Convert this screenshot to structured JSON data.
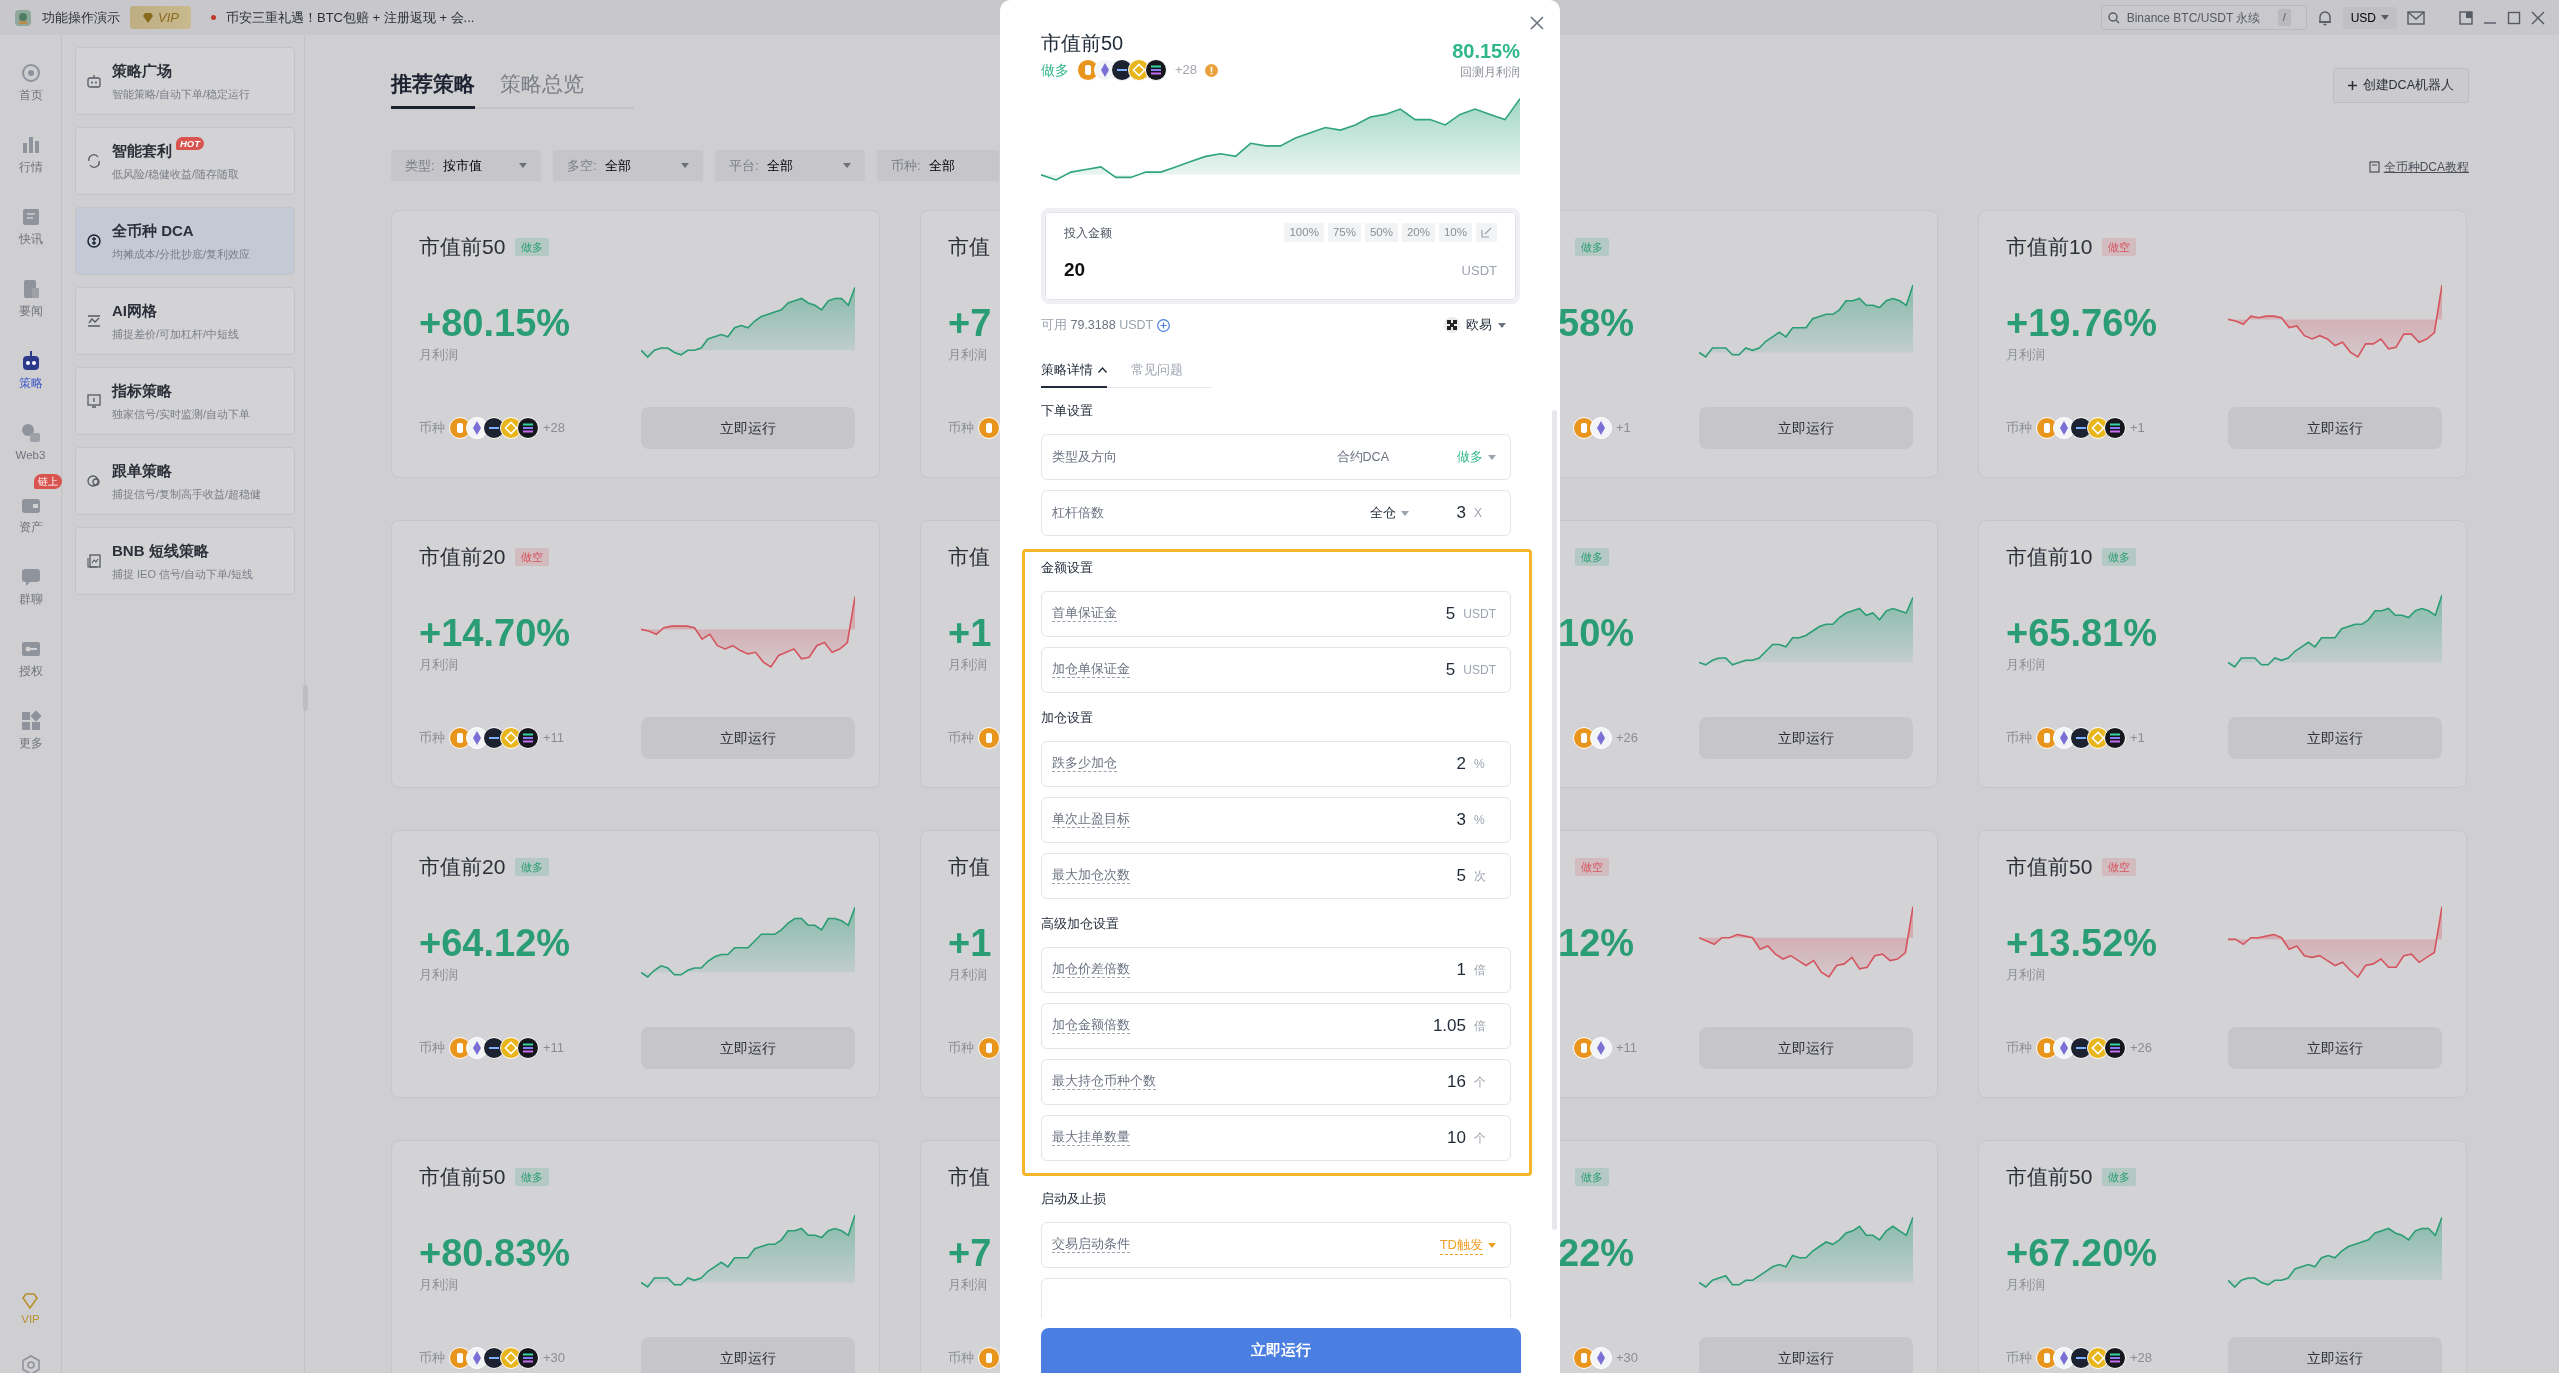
{
  "topbar": {
    "app_name": "功能操作演示",
    "vip": "VIP",
    "notice": "币安三重礼遇！BTC包赔 + 注册返现 + 会...",
    "search_placeholder": "Binance BTC/USDT 永续",
    "search_key": "/",
    "currency": "USD"
  },
  "rail": [
    {
      "label": "首页",
      "selected": false
    },
    {
      "label": "行情",
      "selected": false
    },
    {
      "label": "快讯",
      "selected": false
    },
    {
      "label": "要闻",
      "selected": false
    },
    {
      "label": "策略",
      "selected": true
    },
    {
      "label": "Web3",
      "selected": false
    },
    {
      "label": "资产",
      "selected": false,
      "badge": "链上"
    },
    {
      "label": "群聊",
      "selected": false
    },
    {
      "label": "授权",
      "selected": false
    },
    {
      "label": "更多",
      "selected": false
    }
  ],
  "rail_vip": "VIP",
  "menu": [
    {
      "title": "策略广场",
      "subtitle": "智能策略/自动下单/稳定运行",
      "selected": false
    },
    {
      "title": "智能套利",
      "subtitle": "低风险/稳健收益/随存随取",
      "selected": false,
      "badge": "HOT"
    },
    {
      "title": "全币种 DCA",
      "subtitle": "均摊成本/分批抄底/复利效应",
      "selected": true
    },
    {
      "title": "AI网格",
      "subtitle": "捕捉差价/可加杠杆/中短线",
      "selected": false
    },
    {
      "title": "指标策略",
      "subtitle": "独家信号/实时监测/自动下单",
      "selected": false
    },
    {
      "title": "跟单策略",
      "subtitle": "捕捉信号/复制高手收益/超稳健",
      "selected": false
    },
    {
      "title": "BNB 短线策略",
      "subtitle": "捕捉 IEO 信号/自动下单/短线",
      "selected": false
    }
  ],
  "tabs": [
    {
      "label": "推荐策略",
      "selected": true
    },
    {
      "label": "策略总览",
      "selected": false
    }
  ],
  "create_button": "创建DCA机器人",
  "tutorial_link": "全币种DCA教程",
  "filters": [
    {
      "label": "类型:",
      "value": "按市值",
      "cut": false
    },
    {
      "label": "多空:",
      "value": "全部",
      "cut": false
    },
    {
      "label": "平台:",
      "value": "全部",
      "cut": false
    },
    {
      "label": "币种:",
      "value": "全部",
      "cut": true
    }
  ],
  "cards": [
    {
      "kind": "full",
      "title": "市值前50",
      "tag": {
        "text": "做多",
        "color": "#2a9d75"
      },
      "profit": "+80.15%",
      "profit_label": "月利润",
      "coins_label": "币种",
      "coin_count": "+28",
      "button": "立即运行"
    },
    {
      "kind": "head",
      "title": "市值",
      "profit": "+7",
      "profit_label": "月利润",
      "coins_label": "币种"
    },
    {
      "kind": "tail",
      "tag": {
        "text": "做多",
        "color": "#2a9d75"
      },
      "profit": "58%",
      "coin_count": "+1",
      "button": "立即运行"
    },
    {
      "kind": "full",
      "title": "市值前10",
      "tag": {
        "text": "做空",
        "color": "#d5545e"
      },
      "profit": "+19.76%",
      "profit_label": "月利润",
      "coins_label": "币种",
      "coin_count": "+1",
      "button": "立即运行"
    },
    {
      "kind": "full",
      "title": "市值前20",
      "tag": {
        "text": "做空",
        "color": "#d5545e"
      },
      "profit": "+14.70%",
      "profit_label": "月利润",
      "coins_label": "币种",
      "coin_count": "+11",
      "button": "立即运行"
    },
    {
      "kind": "head",
      "title": "市值",
      "profit": "+1",
      "profit_label": "月利润",
      "coins_label": "币种"
    },
    {
      "kind": "tail",
      "tag": {
        "text": "做多",
        "color": "#2a9d75"
      },
      "profit": "10%",
      "coin_count": "+26",
      "button": "立即运行"
    },
    {
      "kind": "full",
      "title": "市值前10",
      "tag": {
        "text": "做多",
        "color": "#2a9d75"
      },
      "profit": "+65.81%",
      "profit_label": "月利润",
      "coins_label": "币种",
      "coin_count": "+1",
      "button": "立即运行"
    },
    {
      "kind": "full",
      "title": "市值前20",
      "tag": {
        "text": "做多",
        "color": "#2a9d75"
      },
      "profit": "+64.12%",
      "profit_label": "月利润",
      "coins_label": "币种",
      "coin_count": "+11",
      "button": "立即运行"
    },
    {
      "kind": "head",
      "title": "市值",
      "profit": "+1",
      "profit_label": "月利润",
      "coins_label": "币种"
    },
    {
      "kind": "tail",
      "tag": {
        "text": "做空",
        "color": "#d5545e"
      },
      "profit": "12%",
      "coin_count": "+11",
      "button": "立即运行"
    },
    {
      "kind": "full",
      "title": "市值前50",
      "tag": {
        "text": "做空",
        "color": "#d5545e"
      },
      "profit": "+13.52%",
      "profit_label": "月利润",
      "coins_label": "币种",
      "coin_count": "+26",
      "button": "立即运行"
    },
    {
      "kind": "full",
      "title": "市值前50",
      "tag": {
        "text": "做多",
        "color": "#2a9d75"
      },
      "profit": "+80.83%",
      "profit_label": "月利润",
      "coins_label": "币种",
      "coin_count": "+30",
      "button": "立即运行"
    },
    {
      "kind": "head",
      "title": "市值",
      "profit": "+7",
      "profit_label": "月利润",
      "coins_label": "币种"
    },
    {
      "kind": "tail",
      "tag": {
        "text": "做多",
        "color": "#2a9d75"
      },
      "profit": "22%",
      "coin_count": "+30",
      "button": "立即运行"
    },
    {
      "kind": "full",
      "title": "市值前50",
      "tag": {
        "text": "做多",
        "color": "#2a9d75"
      },
      "profit": "+67.20%",
      "profit_label": "月利润",
      "coins_label": "币种",
      "coin_count": "+28",
      "button": "立即运行"
    }
  ],
  "modal": {
    "title": "市值前50",
    "direction": "做多",
    "coin_count": "+28",
    "profit": "80.15%",
    "profit_label": "回测月利润",
    "amount": {
      "label": "投入金额",
      "chips": [
        "100%",
        "75%",
        "50%",
        "20%",
        "10%"
      ],
      "value": "20",
      "unit": "USDT"
    },
    "available": {
      "label": "可用",
      "value": "79.3188",
      "unit": "USDT"
    },
    "exchange": "欧易",
    "tabs": [
      {
        "label": "策略详情",
        "selected": true,
        "expanded": true
      },
      {
        "label": "常见问题",
        "selected": false,
        "expanded": false
      }
    ],
    "sections": [
      {
        "title": "下单设置",
        "highlighted": false,
        "rows": [
          {
            "kind": "select",
            "label": "类型及方向",
            "has_tip": false,
            "option": "合约DCA",
            "value": "做多",
            "color": "#2fb887"
          },
          {
            "kind": "leverage",
            "label": "杠杆倍数",
            "has_tip": false,
            "option": "全仓",
            "value": "3",
            "unit": "X"
          }
        ]
      },
      {
        "title": "金额设置",
        "highlighted": true,
        "rows": [
          {
            "kind": "number",
            "label": "首单保证金",
            "has_tip": true,
            "value": "5",
            "unit": "USDT"
          },
          {
            "kind": "number",
            "label": "加仓单保证金",
            "has_tip": true,
            "value": "5",
            "unit": "USDT"
          }
        ]
      },
      {
        "title": "加仓设置",
        "highlighted": true,
        "rows": [
          {
            "kind": "number",
            "label": "跌多少加仓",
            "has_tip": true,
            "value": "2",
            "unit": "%"
          },
          {
            "kind": "number",
            "label": "单次止盈目标",
            "has_tip": true,
            "value": "3",
            "unit": "%"
          },
          {
            "kind": "number",
            "label": "最大加仓次数",
            "has_tip": true,
            "value": "5",
            "unit": "次"
          }
        ]
      },
      {
        "title": "高级加仓设置",
        "highlighted": true,
        "rows": [
          {
            "kind": "number",
            "label": "加仓价差倍数",
            "has_tip": true,
            "value": "1",
            "unit": "倍"
          },
          {
            "kind": "number",
            "label": "加仓金额倍数",
            "has_tip": true,
            "value": "1.05",
            "unit": "倍"
          },
          {
            "kind": "number",
            "label": "最大持仓币种个数",
            "has_tip": true,
            "value": "16",
            "unit": "个"
          },
          {
            "kind": "number",
            "label": "最大挂单数量",
            "has_tip": true,
            "value": "10",
            "unit": "个"
          }
        ]
      },
      {
        "title": "启动及止损",
        "highlighted": false,
        "rows": [
          {
            "kind": "trigger",
            "label": "交易启动条件",
            "has_tip": true,
            "value": "TD触发",
            "color": "#f0a12b"
          },
          {
            "kind": "blank"
          }
        ]
      }
    ],
    "run_button": "立即运行"
  }
}
